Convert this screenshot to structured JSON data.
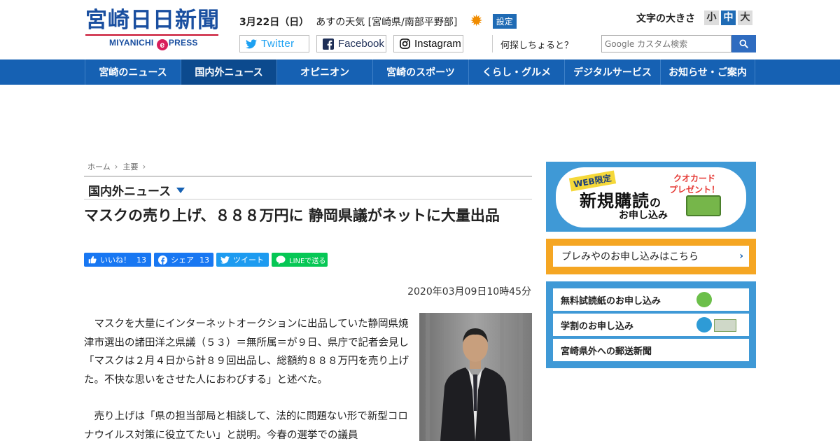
{
  "header": {
    "logo_main": "宮崎日日新聞",
    "logo_sub_pre": "MIYANICHI",
    "logo_sub_e": "e",
    "logo_sub_post": "PRESS",
    "weather_date": "3月22日（日）",
    "weather_label": "あすの天気 [宮崎県/南部平野部]",
    "weather_icon": "sun-icon",
    "settings_label": "設定",
    "font_size_label": "文字の大きさ",
    "font_sizes": [
      "小",
      "中",
      "大"
    ],
    "font_size_selected": "中",
    "social": {
      "twitter": "Twitter",
      "facebook": "Facebook",
      "instagram": "Instagram"
    },
    "what_label": "何探しちょると？",
    "search_placeholder": "Google カスタム検索"
  },
  "nav": {
    "items": [
      "宮崎のニュース",
      "国内外ニュース",
      "オピニオン",
      "宮崎のスポーツ",
      "くらし・グルメ",
      "デジタルサービス",
      "お知らせ・ご案内"
    ],
    "active": "国内外ニュース"
  },
  "breadcrumb": [
    "ホーム",
    "主要"
  ],
  "section_title": "国内外ニュース",
  "article": {
    "title": "マスクの売り上げ、８８８万円に 静岡県議がネットに大量出品",
    "share": {
      "like_label": "いいね！",
      "like_count": "13",
      "share_label": "シェア",
      "share_count": "13",
      "tweet_label": "ツイート",
      "line_label": "LINEで送る"
    },
    "published": "2020年03月09日10時45分",
    "paragraphs": [
      "マスクを大量にインターネットオークションに出品していた静岡県焼津市選出の諸田洋之県議（５３）＝無所属＝が９日、県庁で記者会見し「マスクは２月４日から計８９回出品し、総額約８８８万円を売り上げた。不快な思いをさせた人におわびする」と述べた。",
      "売り上げは「県の担当部局と相談して、法的に問題ない形で新型コロナウイルス対策に役立てたい」と説明。今春の選挙での議員"
    ]
  },
  "sidebar": {
    "promo_web": "WEB限定",
    "promo_big": "新規購読",
    "promo_no": "の",
    "promo_apply": "お申し込み",
    "promo_quo_1": "クオカード",
    "promo_quo_2": "プレゼント！",
    "premi_label": "プレみやのお申し込みはこちら",
    "links": [
      "無料試読紙のお申し込み",
      "学割のお申し込み",
      "宮崎県外への郵送新聞"
    ]
  },
  "colors": {
    "brand_blue": "#1661b3",
    "nav_active": "#0c4a8e",
    "logo_red": "#c8102e",
    "sidebar_blue": "#3f99d6",
    "premi_orange": "#f5a623",
    "line_green": "#06c755"
  }
}
